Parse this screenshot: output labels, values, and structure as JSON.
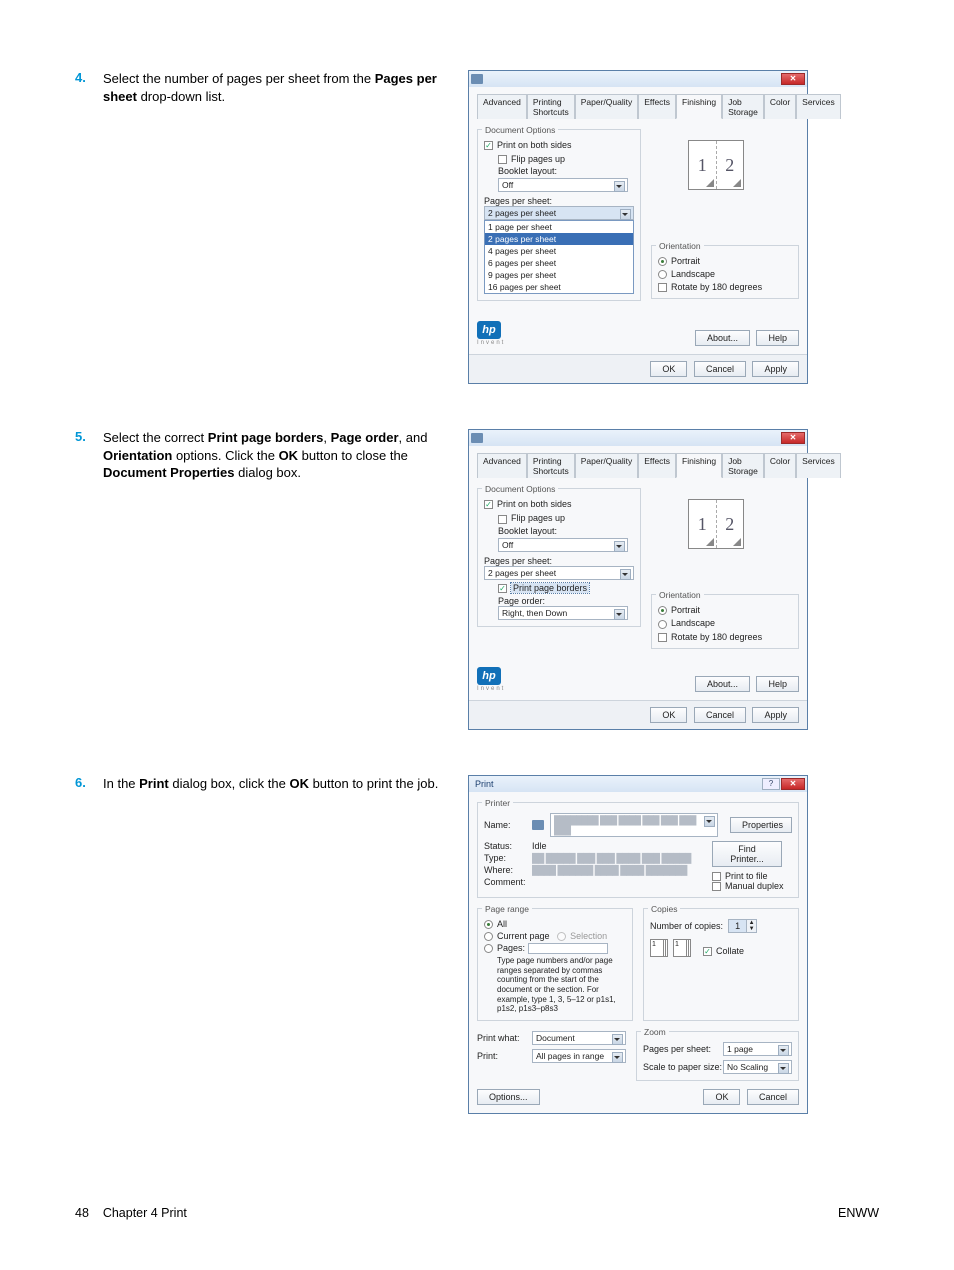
{
  "steps": [
    {
      "number": "4.",
      "text_parts": [
        "Select the number of pages per sheet from the ",
        "Pages per sheet",
        " drop-down list."
      ]
    },
    {
      "number": "5.",
      "text_parts": [
        "Select the correct ",
        "Print page borders",
        ", ",
        "Page order",
        ", and ",
        "Orientation",
        " options. Click the ",
        "OK",
        " button to close the ",
        "Document Properties",
        " dialog box."
      ]
    },
    {
      "number": "6.",
      "text_parts": [
        "In the ",
        "Print",
        " dialog box, click the ",
        "OK",
        " button to print the job."
      ]
    }
  ],
  "tabs": [
    "Advanced",
    "Printing Shortcuts",
    "Paper/Quality",
    "Effects",
    "Finishing",
    "Job Storage",
    "Color",
    "Services"
  ],
  "document_options": {
    "group_label": "Document Options",
    "print_both_sides": "Print on both sides",
    "flip_pages_up": "Flip pages up",
    "booklet_layout": "Booklet layout:",
    "booklet_value": "Off",
    "pages_per_sheet_label": "Pages per sheet:",
    "pages_per_sheet_value": "2 pages per sheet",
    "dropdown_options": [
      "1 page per sheet",
      "2 pages per sheet",
      "4 pages per sheet",
      "6 pages per sheet",
      "9 pages per sheet",
      "16 pages per sheet"
    ],
    "print_page_borders": "Print page borders",
    "page_order_label": "Page order:",
    "page_order_value": "Right, then Down"
  },
  "orientation": {
    "group_label": "Orientation",
    "portrait": "Portrait",
    "landscape": "Landscape",
    "rotate": "Rotate by 180 degrees"
  },
  "preview_pages": [
    "1",
    "2"
  ],
  "buttons": {
    "about": "About...",
    "help": "Help",
    "ok": "OK",
    "cancel": "Cancel",
    "apply": "Apply",
    "properties": "Properties",
    "find_printer": "Find Printer...",
    "options": "Options..."
  },
  "print_dialog": {
    "title": "Print",
    "printer_group": "Printer",
    "name_label": "Name:",
    "status_label": "Status:",
    "status_value": "Idle",
    "type_label": "Type:",
    "where_label": "Where:",
    "comment_label": "Comment:",
    "print_to_file": "Print to file",
    "manual_duplex": "Manual duplex",
    "page_range_group": "Page range",
    "all": "All",
    "current_page": "Current page",
    "selection": "Selection",
    "pages": "Pages:",
    "pages_help": "Type page numbers and/or page ranges separated by commas counting from the start of the document or the section. For example, type 1, 3, 5–12 or p1s1, p1s2, p1s3–p8s3",
    "copies_group": "Copies",
    "num_copies": "Number of copies:",
    "num_copies_value": "1",
    "collate": "Collate",
    "print_what_label": "Print what:",
    "print_what_value": "Document",
    "print_label": "Print:",
    "print_value": "All pages in range",
    "zoom_group": "Zoom",
    "pps_label": "Pages per sheet:",
    "pps_value": "1 page",
    "scale_label": "Scale to paper size:",
    "scale_value": "No Scaling"
  },
  "footer": {
    "left_page": "48",
    "left_text": "Chapter 4   Print",
    "right": "ENWW"
  }
}
